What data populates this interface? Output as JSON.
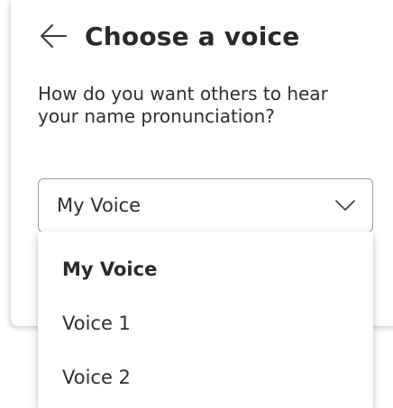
{
  "header": {
    "title": "Choose a voice",
    "back_icon": "arrow-left-icon"
  },
  "question": "How do you want others to hear your name pronunciation?",
  "voice_select": {
    "selected_value": "My Voice",
    "chevron_icon": "chevron-down-icon",
    "options": [
      {
        "label": "My Voice",
        "selected": true
      },
      {
        "label": "Voice 1",
        "selected": false
      },
      {
        "label": "Voice 2",
        "selected": false
      }
    ]
  }
}
